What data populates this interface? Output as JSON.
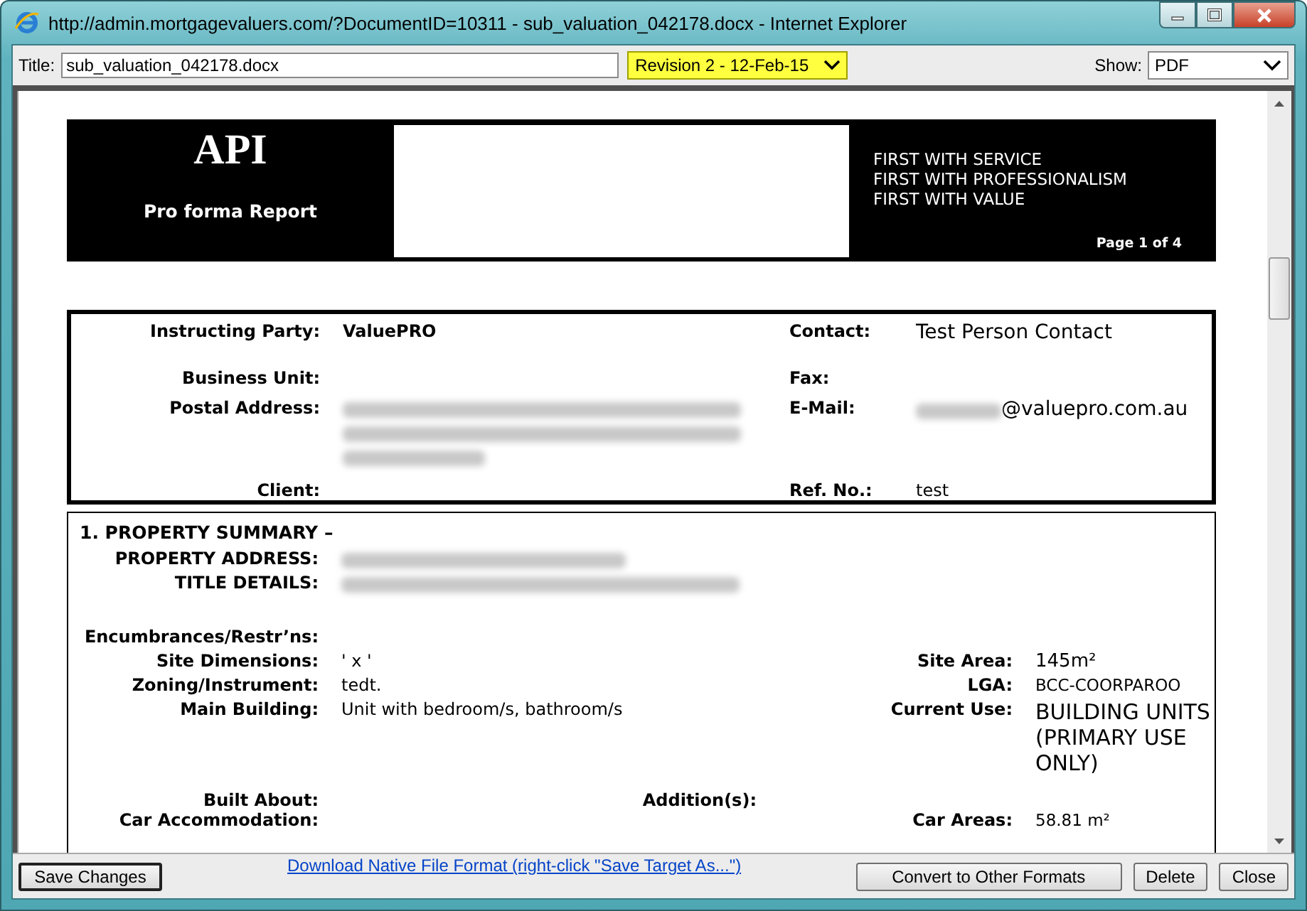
{
  "window": {
    "title": "http://admin.mortgagevaluers.com/?DocumentID=10311 - sub_valuation_042178.docx - Internet Explorer"
  },
  "toolbar": {
    "title_label": "Title:",
    "title_value": "sub_valuation_042178.docx",
    "revision": "Revision 2 - 12-Feb-15",
    "show_label": "Show:",
    "show_value": "PDF"
  },
  "document": {
    "header": {
      "logo": "API",
      "subtitle": "Pro forma Report",
      "taglines": [
        "FIRST WITH SERVICE",
        "FIRST WITH PROFESSIONALISM",
        "FIRST WITH VALUE"
      ],
      "page": "Page 1 of 4"
    },
    "parties": [
      {
        "label": "Instructing Party:",
        "value": "ValuePRO",
        "right_label": "Contact:",
        "right_value": "Test Person Contact"
      },
      {
        "label": "Business Unit:",
        "right_label": "Fax:"
      },
      {
        "label": "Postal Address:",
        "kind": "redacted_address",
        "right_label": "E-Mail:",
        "right_redacted": true,
        "right_value": "@valuepro.com.au"
      },
      {
        "label": "Client:",
        "right_label": "Ref. No.:",
        "right_value": "test"
      }
    ],
    "summary": {
      "title": "1.  PROPERTY SUMMARY –",
      "rows": [
        {
          "label": "PROPERTY ADDRESS:",
          "kind": "redacted_medium"
        },
        {
          "label": "TITLE DETAILS:",
          "kind": "redacted_long"
        },
        {
          "label": "Encumbrances/Restr’ns:"
        },
        {
          "label": "Site Dimensions:",
          "value": "' x '",
          "right_label": "Site Area:",
          "right_value": "145m²"
        },
        {
          "label": "Zoning/Instrument:",
          "value": "tedt.",
          "right_label": "LGA:",
          "right_value": "BCC-COORPAROO"
        },
        {
          "label": "Main Building:",
          "value": "Unit with  bedroom/s,  bathroom/s",
          "right_label": "Current Use:",
          "right_value": "BUILDING UNITS (PRIMARY USE ONLY)"
        },
        {
          "label": "Built About:",
          "mid_label": "Addition(s):"
        },
        {
          "label": "Car Accommodation:",
          "right_label": "Car Areas:",
          "right_value": "58.81 m²"
        }
      ]
    }
  },
  "footer": {
    "save": "Save Changes",
    "download_link": "Download Native File Format (right-click \"Save Target As...\")",
    "convert": "Convert to Other Formats",
    "delete": "Delete",
    "close": "Close"
  }
}
